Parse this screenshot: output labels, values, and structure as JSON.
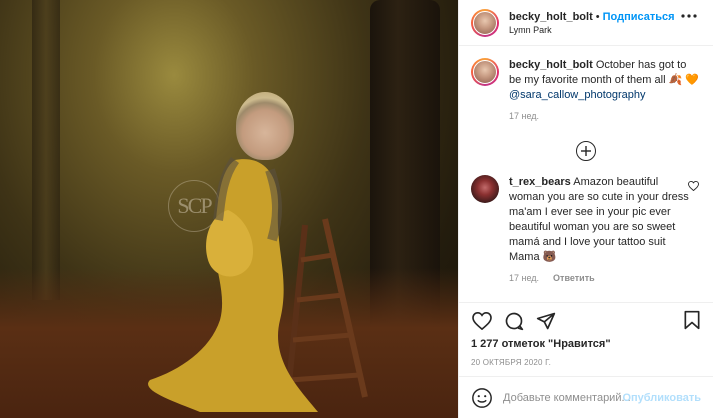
{
  "header": {
    "username": "becky_holt_bolt",
    "separator": "•",
    "follow_label": "Подписаться",
    "location": "Lymn Park",
    "more_icon": "more-horizontal-icon"
  },
  "caption": {
    "username": "becky_holt_bolt",
    "text": "October has got to be my favorite month of them all",
    "emoji_1": "🍂",
    "emoji_2": "🧡",
    "mention": "@sara_callow_photography",
    "time": "17 нед."
  },
  "load_more_icon": "plus-circle-icon",
  "comment": {
    "username": "t_rex_bears",
    "text": "Amazon beautiful woman you are so cute in your dress ma'am I ever see in your pic ever beautiful woman you are so sweet mamá and I love your tattoo suit Mama",
    "emoji": "🐻",
    "time": "17 нед.",
    "reply_label": "Ответить",
    "heart_icon": "heart-outline-icon"
  },
  "actions": {
    "like_icon": "heart-outline-icon",
    "comment_icon": "comment-bubble-icon",
    "share_icon": "paper-plane-icon",
    "save_icon": "bookmark-icon"
  },
  "likes_text": "1 277 отметок \"Нравится\"",
  "date_text": "20 ОКТЯБРЯ 2020 Г.",
  "add_comment": {
    "placeholder": "Добавьте комментарий...",
    "publish_label": "Опубликовать",
    "emoji_icon": "smile-icon"
  },
  "photo": {
    "watermark": "SCP",
    "colors": {
      "dress": "#c9a02a",
      "foliage": "#5a2f14"
    }
  },
  "colors": {
    "accent": "#0095f6",
    "text": "#262626",
    "muted": "#8e8e8e",
    "mention": "#00376b"
  }
}
